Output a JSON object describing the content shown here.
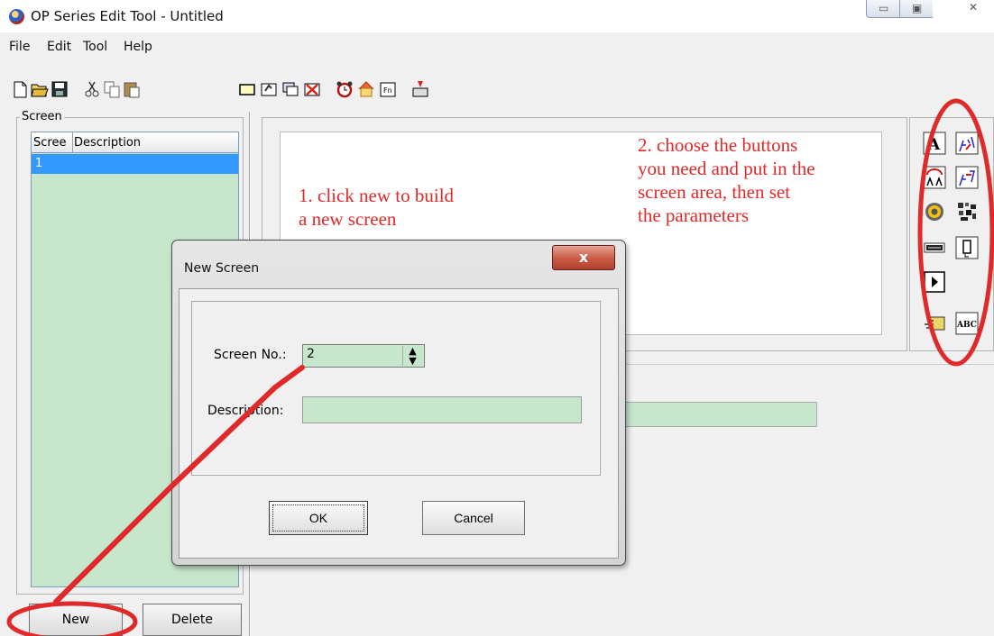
{
  "app": {
    "title": "OP Series Edit Tool - Untitled"
  },
  "menu": [
    "File",
    "Edit",
    "Tool",
    "Help"
  ],
  "toolbar": {
    "icons": [
      "new-file-icon",
      "open-folder-icon",
      "save-icon",
      "cut-icon",
      "copy-icon",
      "paste-icon",
      "add-screen-icon",
      "screen-properties-icon",
      "copy-screen-icon",
      "delete-screen-icon",
      "alarm-icon",
      "home-screen-icon",
      "function-key-icon",
      "download-icon"
    ]
  },
  "screen_panel": {
    "legend": "Screen",
    "columns": [
      "Scree",
      "Description"
    ],
    "rows": [
      {
        "screen": "1",
        "description": ""
      }
    ],
    "new_label": "New",
    "delete_label": "Delete"
  },
  "annotations": {
    "step1": [
      "1. click new to build",
      "a new screen"
    ],
    "step2": [
      "2. choose the buttons",
      "you need and put in the",
      "screen area, then set",
      "the parameters"
    ],
    "color": "#e02a2a"
  },
  "palette": {
    "icons": [
      "static-text-icon",
      "numeric-display-icon",
      "text-toggle-icon",
      "numeric-input-icon",
      "lamp-icon",
      "bitmap-icon",
      "bar-graph-icon",
      "set-value-icon",
      "goto-screen-icon",
      "touch-key-icon",
      "ascii-input-icon"
    ],
    "labels": {
      "text": "A",
      "ascii": "ABC"
    }
  },
  "dialog": {
    "title": "New Screen",
    "close_glyph": "x",
    "screen_no_label": "Screen No.:",
    "screen_no_value": "2",
    "description_label": "Description:",
    "description_value": "",
    "ok_label": "OK",
    "cancel_label": "Cancel"
  },
  "colors": {
    "field_green": "#c6e7cb",
    "selection": "#3399ff",
    "annotation": "#e02a2a"
  }
}
